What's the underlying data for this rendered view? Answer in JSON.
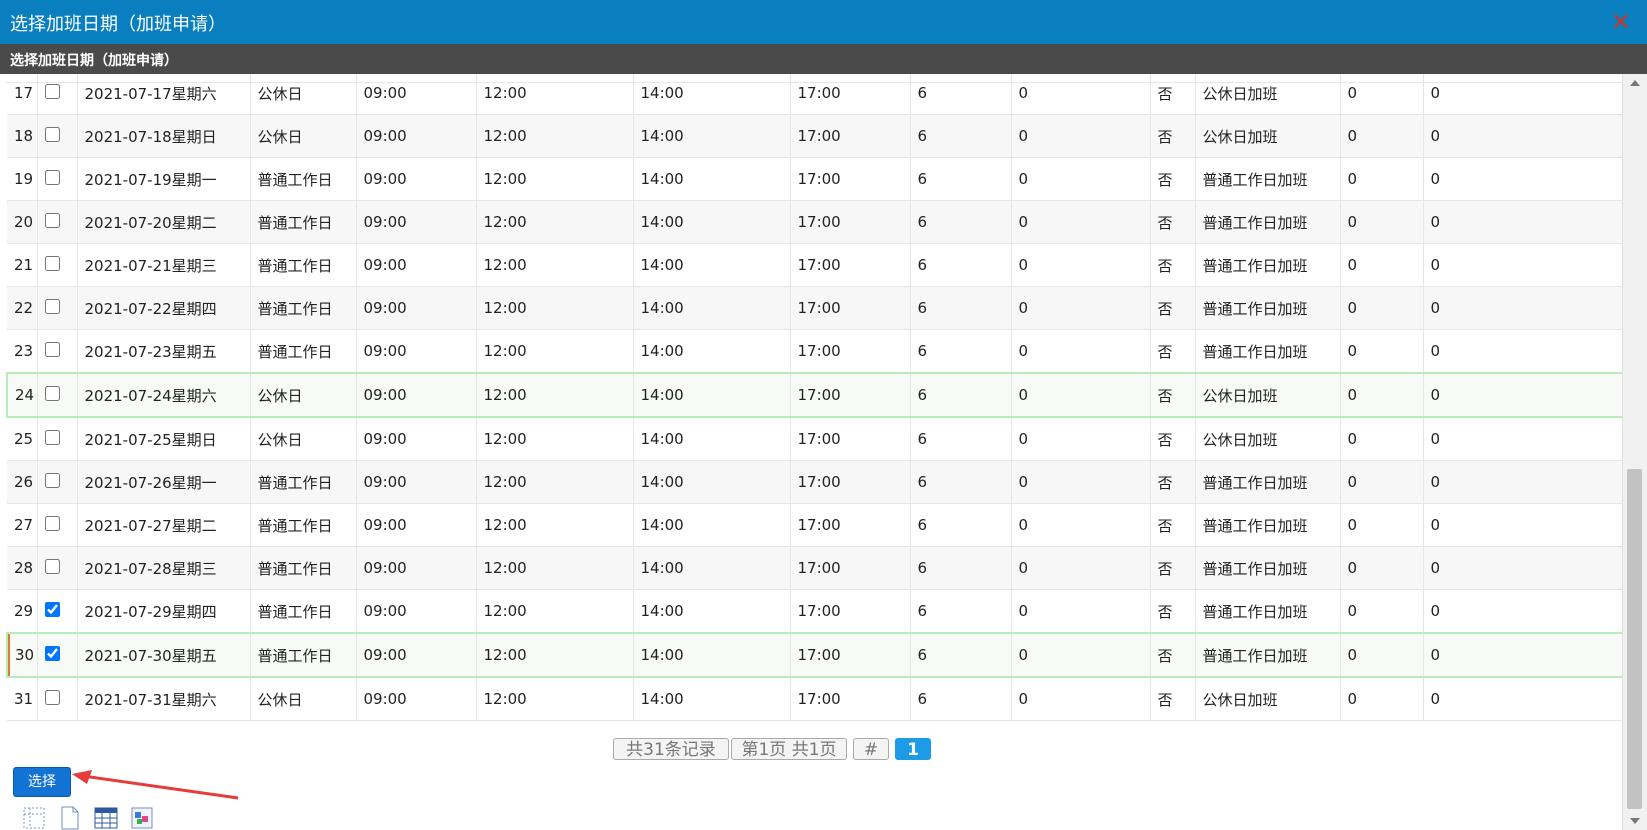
{
  "window": {
    "title": "选择加班日期（加班申请）",
    "subtitle": "选择加班日期（加班申请）",
    "close_glyph": "✕"
  },
  "rows": [
    {
      "no": "17",
      "checked": false,
      "date": "2021-07-17星期六",
      "daytype": "公休日",
      "t1": "09:00",
      "t2": "12:00",
      "t3": "14:00",
      "t4": "17:00",
      "hours": "6",
      "v1": "0",
      "flag": "否",
      "otype": "公休日加班",
      "v2": "0",
      "v3": "0"
    },
    {
      "no": "18",
      "checked": false,
      "date": "2021-07-18星期日",
      "daytype": "公休日",
      "t1": "09:00",
      "t2": "12:00",
      "t3": "14:00",
      "t4": "17:00",
      "hours": "6",
      "v1": "0",
      "flag": "否",
      "otype": "公休日加班",
      "v2": "0",
      "v3": "0"
    },
    {
      "no": "19",
      "checked": false,
      "date": "2021-07-19星期一",
      "daytype": "普通工作日",
      "t1": "09:00",
      "t2": "12:00",
      "t3": "14:00",
      "t4": "17:00",
      "hours": "6",
      "v1": "0",
      "flag": "否",
      "otype": "普通工作日加班",
      "v2": "0",
      "v3": "0"
    },
    {
      "no": "20",
      "checked": false,
      "date": "2021-07-20星期二",
      "daytype": "普通工作日",
      "t1": "09:00",
      "t2": "12:00",
      "t3": "14:00",
      "t4": "17:00",
      "hours": "6",
      "v1": "0",
      "flag": "否",
      "otype": "普通工作日加班",
      "v2": "0",
      "v3": "0"
    },
    {
      "no": "21",
      "checked": false,
      "date": "2021-07-21星期三",
      "daytype": "普通工作日",
      "t1": "09:00",
      "t2": "12:00",
      "t3": "14:00",
      "t4": "17:00",
      "hours": "6",
      "v1": "0",
      "flag": "否",
      "otype": "普通工作日加班",
      "v2": "0",
      "v3": "0"
    },
    {
      "no": "22",
      "checked": false,
      "date": "2021-07-22星期四",
      "daytype": "普通工作日",
      "t1": "09:00",
      "t2": "12:00",
      "t3": "14:00",
      "t4": "17:00",
      "hours": "6",
      "v1": "0",
      "flag": "否",
      "otype": "普通工作日加班",
      "v2": "0",
      "v3": "0"
    },
    {
      "no": "23",
      "checked": false,
      "date": "2021-07-23星期五",
      "daytype": "普通工作日",
      "t1": "09:00",
      "t2": "12:00",
      "t3": "14:00",
      "t4": "17:00",
      "hours": "6",
      "v1": "0",
      "flag": "否",
      "otype": "普通工作日加班",
      "v2": "0",
      "v3": "0"
    },
    {
      "no": "24",
      "checked": false,
      "date": "2021-07-24星期六",
      "daytype": "公休日",
      "t1": "09:00",
      "t2": "12:00",
      "t3": "14:00",
      "t4": "17:00",
      "hours": "6",
      "v1": "0",
      "flag": "否",
      "otype": "公休日加班",
      "v2": "0",
      "v3": "0",
      "highlight": true
    },
    {
      "no": "25",
      "checked": false,
      "date": "2021-07-25星期日",
      "daytype": "公休日",
      "t1": "09:00",
      "t2": "12:00",
      "t3": "14:00",
      "t4": "17:00",
      "hours": "6",
      "v1": "0",
      "flag": "否",
      "otype": "公休日加班",
      "v2": "0",
      "v3": "0"
    },
    {
      "no": "26",
      "checked": false,
      "date": "2021-07-26星期一",
      "daytype": "普通工作日",
      "t1": "09:00",
      "t2": "12:00",
      "t3": "14:00",
      "t4": "17:00",
      "hours": "6",
      "v1": "0",
      "flag": "否",
      "otype": "普通工作日加班",
      "v2": "0",
      "v3": "0"
    },
    {
      "no": "27",
      "checked": false,
      "date": "2021-07-27星期二",
      "daytype": "普通工作日",
      "t1": "09:00",
      "t2": "12:00",
      "t3": "14:00",
      "t4": "17:00",
      "hours": "6",
      "v1": "0",
      "flag": "否",
      "otype": "普通工作日加班",
      "v2": "0",
      "v3": "0"
    },
    {
      "no": "28",
      "checked": false,
      "date": "2021-07-28星期三",
      "daytype": "普通工作日",
      "t1": "09:00",
      "t2": "12:00",
      "t3": "14:00",
      "t4": "17:00",
      "hours": "6",
      "v1": "0",
      "flag": "否",
      "otype": "普通工作日加班",
      "v2": "0",
      "v3": "0"
    },
    {
      "no": "29",
      "checked": true,
      "date": "2021-07-29星期四",
      "daytype": "普通工作日",
      "t1": "09:00",
      "t2": "12:00",
      "t3": "14:00",
      "t4": "17:00",
      "hours": "6",
      "v1": "0",
      "flag": "否",
      "otype": "普通工作日加班",
      "v2": "0",
      "v3": "0"
    },
    {
      "no": "30",
      "checked": true,
      "date": "2021-07-30星期五",
      "daytype": "普通工作日",
      "t1": "09:00",
      "t2": "12:00",
      "t3": "14:00",
      "t4": "17:00",
      "hours": "6",
      "v1": "0",
      "flag": "否",
      "otype": "普通工作日加班",
      "v2": "0",
      "v3": "0",
      "highlight": true,
      "current": true
    },
    {
      "no": "31",
      "checked": false,
      "date": "2021-07-31星期六",
      "daytype": "公休日",
      "t1": "09:00",
      "t2": "12:00",
      "t3": "14:00",
      "t4": "17:00",
      "hours": "6",
      "v1": "0",
      "flag": "否",
      "otype": "公休日加班",
      "v2": "0",
      "v3": "0"
    }
  ],
  "pager": {
    "total": "共31条记录",
    "pages": "第1页 共1页",
    "hash": "#",
    "current": "1"
  },
  "actions": {
    "select_label": "选择"
  },
  "colors": {
    "titlebar": "#0a7fc0",
    "subbar": "#4a4a4a",
    "button": "#1273d4",
    "pager_current": "#1e9be6",
    "row_highlight_border": "#b7eeb7",
    "arrow": "#e63b3b"
  },
  "icons": [
    "grid-dotted-icon",
    "blank-page-icon",
    "calendar-table-icon",
    "puzzle-color-icon"
  ]
}
